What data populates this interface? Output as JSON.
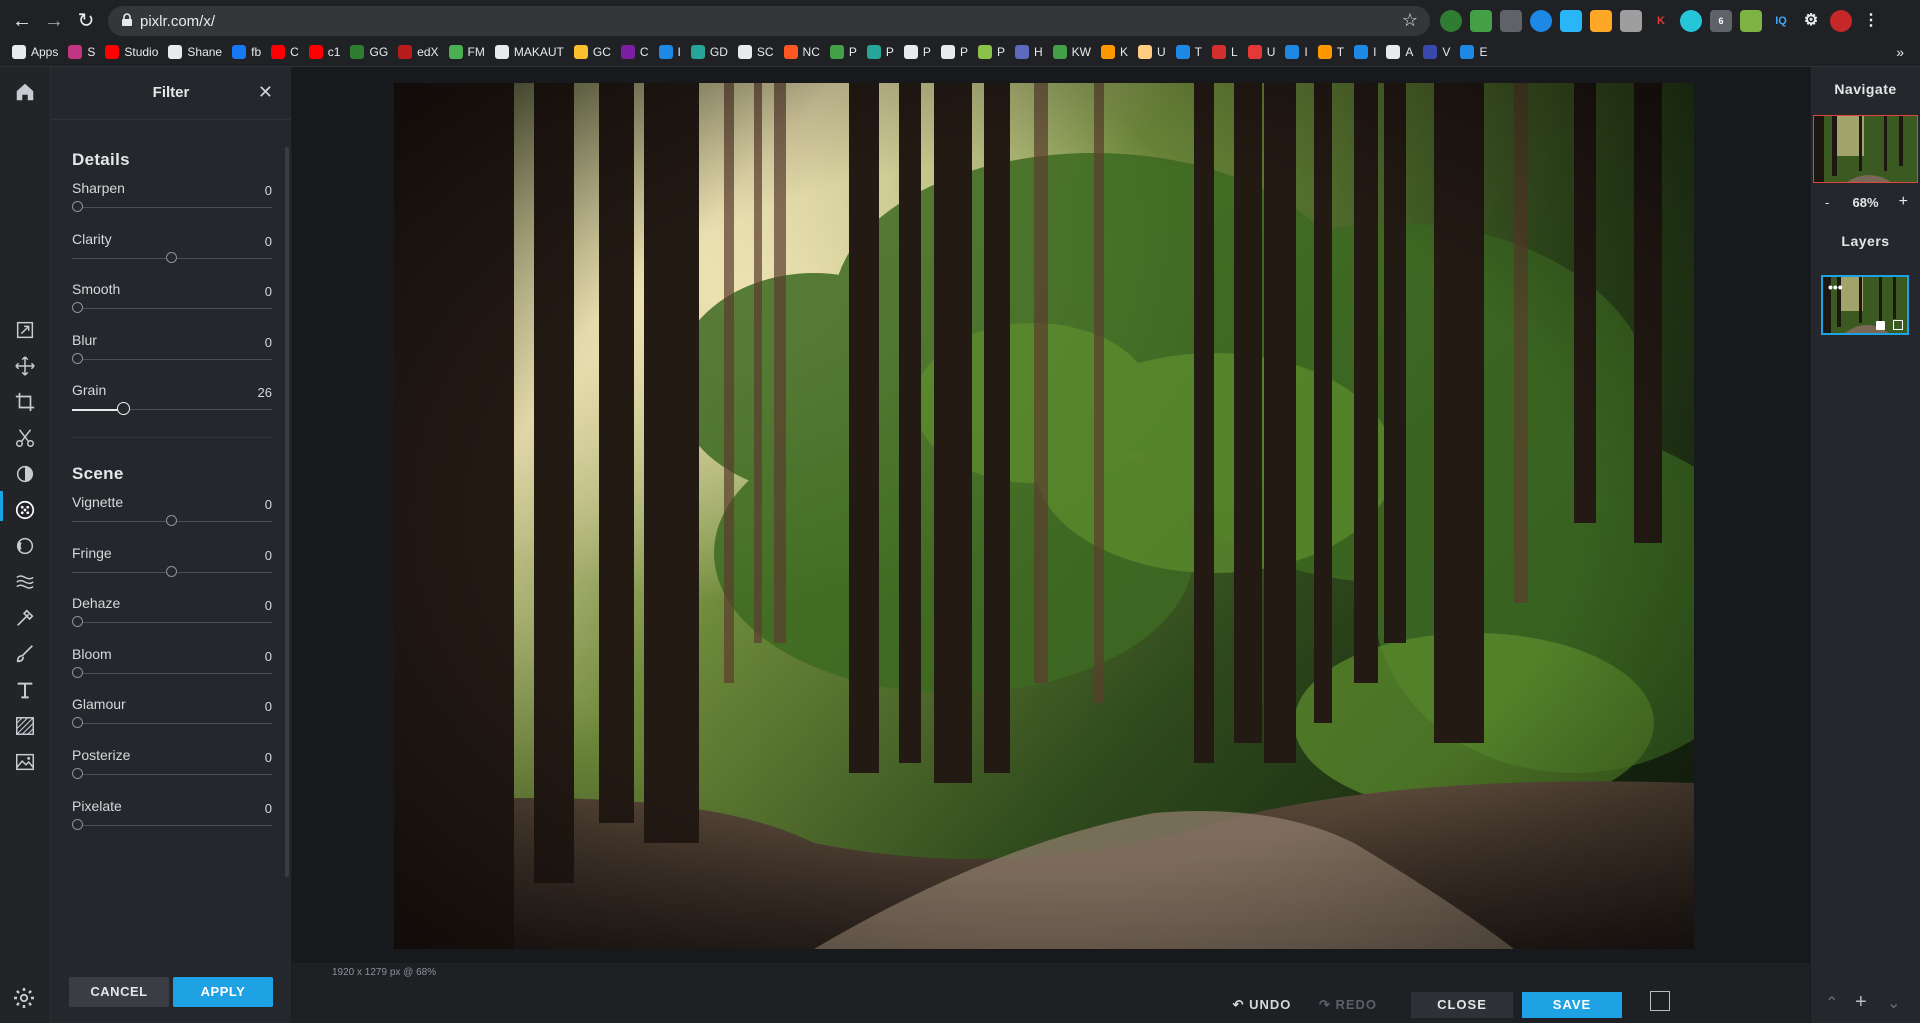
{
  "browser": {
    "url": "pixlr.com/x/",
    "badge_count": "6",
    "bookmarks": [
      {
        "label": "Apps",
        "color": "#e8eaed"
      },
      {
        "label": "S",
        "color": "#c13584"
      },
      {
        "label": "Studio",
        "color": "#ff0000"
      },
      {
        "label": "Shane",
        "color": "#e8eaed"
      },
      {
        "label": "fb",
        "color": "#1877f2"
      },
      {
        "label": "C",
        "color": "#ff0000"
      },
      {
        "label": "c1",
        "color": "#ff0000"
      },
      {
        "label": "GG",
        "color": "#2e7d32"
      },
      {
        "label": "edX",
        "color": "#b71c1c"
      },
      {
        "label": "FM",
        "color": "#4caf50"
      },
      {
        "label": "MAKAUT",
        "color": "#e8eaed"
      },
      {
        "label": "GC",
        "color": "#fbc02d"
      },
      {
        "label": "C",
        "color": "#7b1fa2"
      },
      {
        "label": "I",
        "color": "#1e88e5"
      },
      {
        "label": "GD",
        "color": "#26a69a"
      },
      {
        "label": "SC",
        "color": "#e8eaed"
      },
      {
        "label": "NC",
        "color": "#ff5722"
      },
      {
        "label": "P",
        "color": "#43a047"
      },
      {
        "label": "P",
        "color": "#26a69a"
      },
      {
        "label": "P",
        "color": "#e8eaed"
      },
      {
        "label": "P",
        "color": "#e8eaed"
      },
      {
        "label": "P",
        "color": "#8bc34a"
      },
      {
        "label": "H",
        "color": "#5c6bc0"
      },
      {
        "label": "KW",
        "color": "#43a047"
      },
      {
        "label": "K",
        "color": "#ff9800"
      },
      {
        "label": "U",
        "color": "#ffcc80"
      },
      {
        "label": "T",
        "color": "#1e88e5"
      },
      {
        "label": "L",
        "color": "#d32f2f"
      },
      {
        "label": "U",
        "color": "#e53935"
      },
      {
        "label": "I",
        "color": "#1e88e5"
      },
      {
        "label": "T",
        "color": "#ff9800"
      },
      {
        "label": "I",
        "color": "#1e88e5"
      },
      {
        "label": "A",
        "color": "#e8eaed"
      },
      {
        "label": "V",
        "color": "#3949ab"
      },
      {
        "label": "E",
        "color": "#1e88e5"
      }
    ]
  },
  "filter": {
    "title": "Filter",
    "details_heading": "Details",
    "scene_heading": "Scene",
    "details": [
      {
        "name": "sharpen",
        "label": "Sharpen",
        "value": "0",
        "pos": 0
      },
      {
        "name": "clarity",
        "label": "Clarity",
        "value": "0",
        "pos": 0.5
      },
      {
        "name": "smooth",
        "label": "Smooth",
        "value": "0",
        "pos": 0
      },
      {
        "name": "blur",
        "label": "Blur",
        "value": "0",
        "pos": 0
      },
      {
        "name": "grain",
        "label": "Grain",
        "value": "26",
        "pos": 0.26
      }
    ],
    "scene": [
      {
        "name": "vignette",
        "label": "Vignette",
        "value": "0",
        "pos": 0.5
      },
      {
        "name": "fringe",
        "label": "Fringe",
        "value": "0",
        "pos": 0.5
      },
      {
        "name": "dehaze",
        "label": "Dehaze",
        "value": "0",
        "pos": 0
      },
      {
        "name": "bloom",
        "label": "Bloom",
        "value": "0",
        "pos": 0
      },
      {
        "name": "glamour",
        "label": "Glamour",
        "value": "0",
        "pos": 0
      },
      {
        "name": "posterize",
        "label": "Posterize",
        "value": "0",
        "pos": 0
      },
      {
        "name": "pixelate",
        "label": "Pixelate",
        "value": "0",
        "pos": 0
      }
    ],
    "cancel_label": "CANCEL",
    "apply_label": "APPLY"
  },
  "canvas": {
    "status": "1920 x 1279 px @ 68%"
  },
  "actions": {
    "undo_label": "UNDO",
    "redo_label": "REDO",
    "close_label": "CLOSE",
    "save_label": "SAVE"
  },
  "navigate": {
    "title": "Navigate",
    "zoom_minus": "-",
    "zoom_value": "68%",
    "zoom_plus": "+"
  },
  "layers": {
    "title": "Layers"
  },
  "colors": {
    "accent": "#1ea2e3",
    "panel_bg": "#24272b",
    "nav_frame": "#e0473a"
  }
}
